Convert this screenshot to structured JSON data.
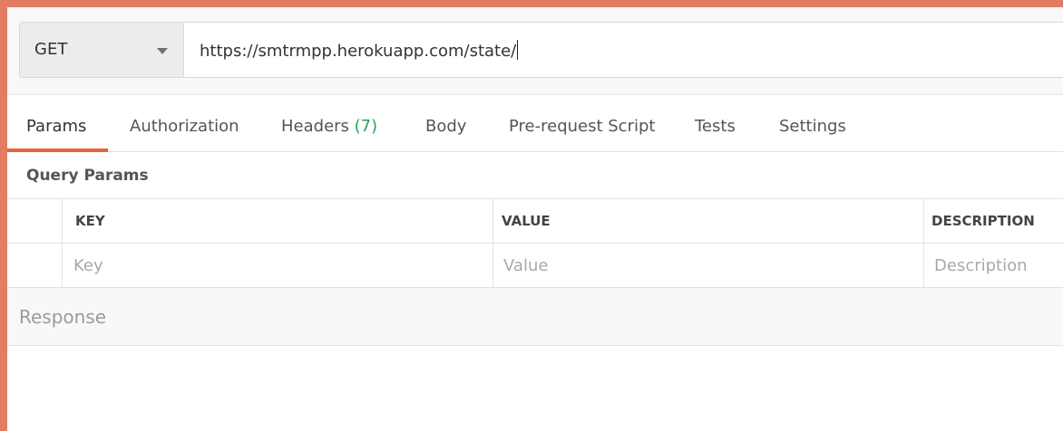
{
  "request": {
    "method": "GET",
    "url": "https://smtrmpp.herokuapp.com/state/"
  },
  "tabs": [
    {
      "label": "Params",
      "active": true
    },
    {
      "label": "Authorization"
    },
    {
      "label": "Headers",
      "count": "(7)"
    },
    {
      "label": "Body"
    },
    {
      "label": "Pre-request Script"
    },
    {
      "label": "Tests"
    },
    {
      "label": "Settings"
    }
  ],
  "query_params": {
    "title": "Query Params",
    "columns": [
      "KEY",
      "VALUE",
      "DESCRIPTION"
    ],
    "placeholders": [
      "Key",
      "Value",
      "Description"
    ]
  },
  "response": {
    "label": "Response"
  },
  "colors": {
    "accent": "#e8643a",
    "count": "#26a35a",
    "frame": "#e27d63"
  }
}
